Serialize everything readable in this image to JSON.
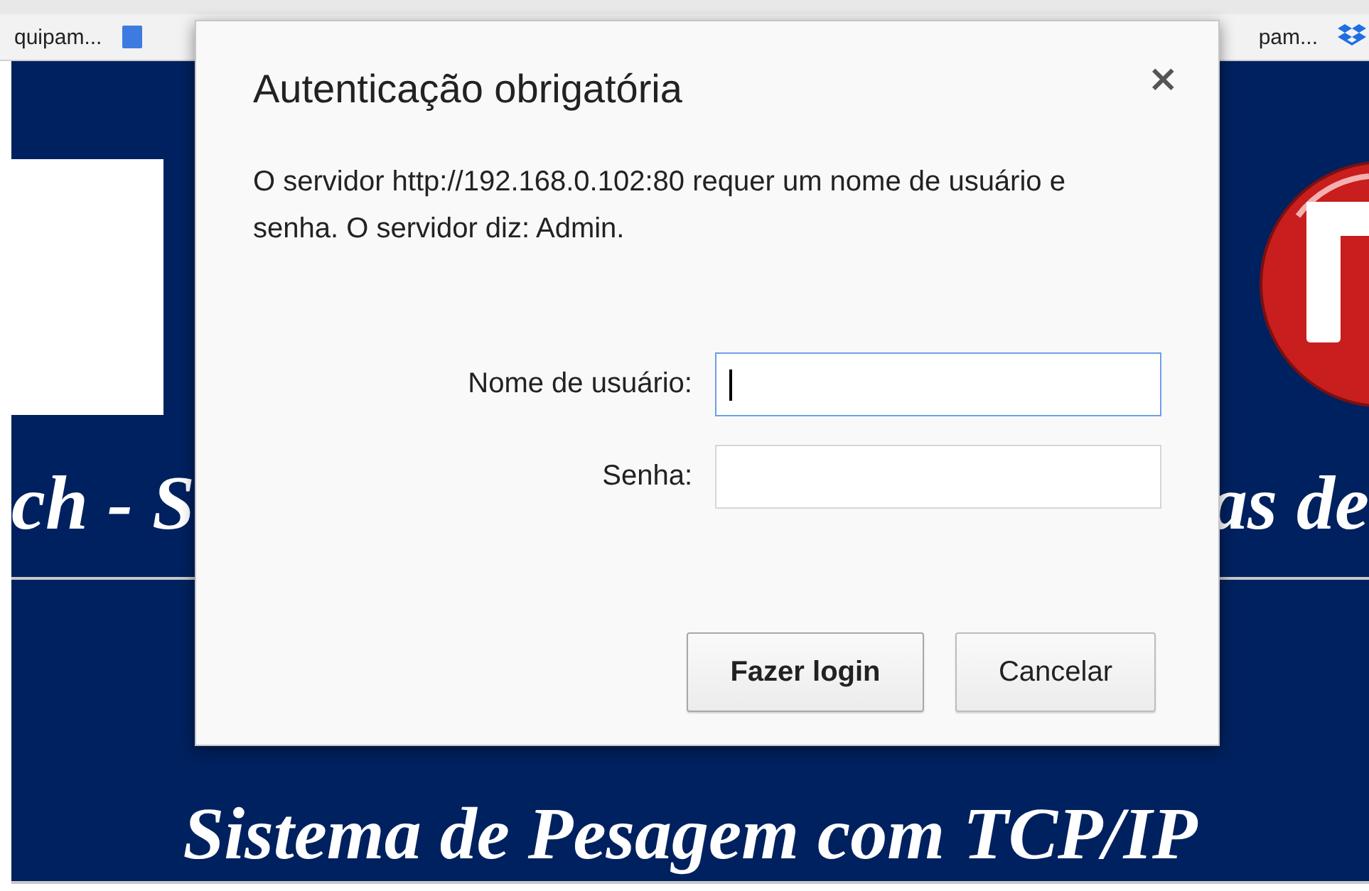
{
  "bookmarks_bar": {
    "items": [
      {
        "label": "quipam...",
        "kind": "text"
      },
      {
        "kind": "doc-icon"
      },
      {
        "label": "pam...",
        "kind": "text"
      },
      {
        "kind": "box-icon"
      }
    ]
  },
  "page": {
    "heading_left": "ch - S",
    "heading_right": "as de",
    "subtitle": "Sistema de Pesagem com TCP/IP"
  },
  "dialog": {
    "title": "Autenticação obrigatória",
    "close": "×",
    "message": "O servidor http://192.168.0.102:80 requer um nome de usuário e senha. O servidor diz: Admin.",
    "fields": [
      {
        "label": "Nome de usuário:",
        "focused": true
      },
      {
        "label": "Senha:",
        "focused": false
      }
    ],
    "buttons": [
      {
        "label": "Fazer login",
        "default": true
      },
      {
        "label": "Cancelar",
        "default": false
      }
    ]
  }
}
